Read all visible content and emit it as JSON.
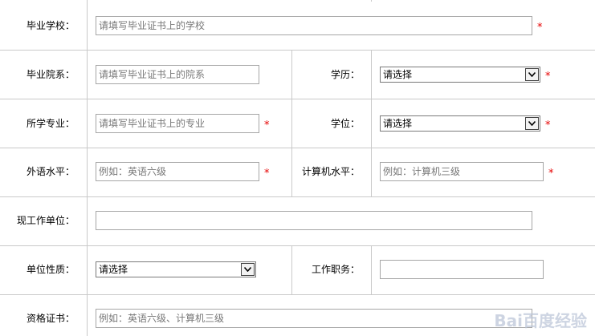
{
  "form": {
    "school_label": "毕业学校：",
    "school_placeholder": "请填写毕业证书上的学校",
    "department_label": "毕业院系：",
    "department_placeholder": "请填写毕业证书上的院系",
    "education_label": "学历：",
    "education_value": "请选择",
    "major_label": "所学专业：",
    "major_placeholder": "请填写毕业证书上的专业",
    "degree_label": "学位：",
    "degree_value": "请选择",
    "language_label": "外语水平：",
    "language_placeholder": "例如：英语六级",
    "computer_label": "计算机水平：",
    "computer_placeholder": "例如：计算机三级",
    "employer_label": "现工作单位：",
    "employer_value": "",
    "unit_type_label": "单位性质：",
    "unit_type_value": "请选择",
    "job_title_label": "工作职务：",
    "job_title_value": "",
    "certificate_label": "资格证书：",
    "certificate_placeholder": "例如：英语六级、计算机三级",
    "required_mark": "*"
  },
  "colors": {
    "border": "#c9c9c9",
    "required": "#e60000",
    "placeholder": "#777777"
  },
  "watermark": "Bai百度经验"
}
